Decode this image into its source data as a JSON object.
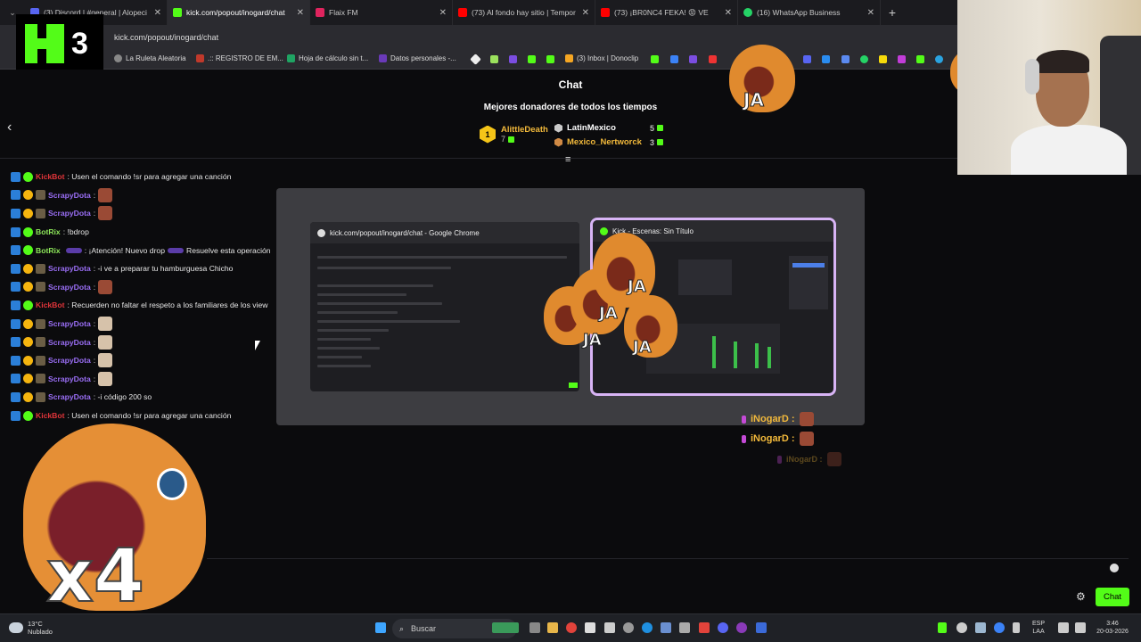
{
  "browser": {
    "tabs": [
      {
        "label": "(3) Discord | #general | Alopeci",
        "color": "#5865f2",
        "active": false
      },
      {
        "label": "kick.com/popout/inogard/chat",
        "color": "#53fc18",
        "active": true
      },
      {
        "label": "Flaix FM",
        "color": "#e0245e",
        "active": false
      },
      {
        "label": "(73) Al fondo hay sitio | Tempor",
        "color": "#ff0000",
        "active": false
      },
      {
        "label": "(73) ¡BR0NC4 FEKA! 😡 VE",
        "color": "#ff0000",
        "active": false
      },
      {
        "label": "(16) WhatsApp Business",
        "color": "#25d366",
        "active": false
      }
    ],
    "url": "kick.com/popout/inogard/chat",
    "bookmarks": [
      {
        "label": "La Ruleta Aleatoria",
        "color": "#888888"
      },
      {
        "label": ".:: REGISTRO DE EM...",
        "color": "#c0392b"
      },
      {
        "label": "Hoja de cálculo sin t...",
        "color": "#1fa463"
      },
      {
        "label": "Datos personales -...",
        "color": "#6a3ab8"
      },
      {
        "label": "(3) Inbox | Donoclip",
        "color": "#f5a623"
      }
    ]
  },
  "logo": {
    "number": "3"
  },
  "chat": {
    "title": "Chat",
    "donors_title": "Mejores donadores de todos los tiempos",
    "top_donor": {
      "rank": "1",
      "name": "AlittleDeath",
      "count": "7"
    },
    "donors": [
      {
        "name": "LatinMexico",
        "count": "5"
      },
      {
        "name": "Mexico_Nertworck",
        "count": "3"
      }
    ],
    "messages": [
      {
        "user": "KickBot",
        "text": ": Usen el comando !sr para agregar una canción"
      },
      {
        "user": "ScrapyDota",
        "text": ":"
      },
      {
        "user": "ScrapyDota",
        "text": ":"
      },
      {
        "user": "BotRix",
        "text": ": !bdrop"
      },
      {
        "user": "BotRix",
        "text": ": ¡Atención! Nuevo drop",
        "extra": "Resuelve esta operación"
      },
      {
        "user": "ScrapyDota",
        "text": ": -i ve a preparar tu hamburguesa Chicho"
      },
      {
        "user": "ScrapyDota",
        "text": ":"
      },
      {
        "user": "KickBot",
        "text": ": Recuerden no faltar el respeto a los familiares de los view"
      },
      {
        "user": "ScrapyDota",
        "text": ":"
      },
      {
        "user": "ScrapyDota",
        "text": ":"
      },
      {
        "user": "ScrapyDota",
        "text": ":"
      },
      {
        "user": "ScrapyDota",
        "text": ":"
      },
      {
        "user": "ScrapyDota",
        "text": ": -i código 200 so"
      },
      {
        "user": "KickBot",
        "text": ": Usen el comando !sr para agregar una canción"
      }
    ],
    "role_rows": [
      "iNogarD :",
      "iNogarD :",
      "iNogarD :"
    ],
    "send_label": "Chat"
  },
  "alttab": {
    "win1_title": "kick.com/popout/inogard/chat - Google Chrome",
    "win2_title": "Kick - Escenas: Sin Título"
  },
  "overlay": {
    "ja": "JA",
    "multiplier": "x4"
  },
  "taskbar": {
    "weather_temp": "13°C",
    "weather_desc": "Nublado",
    "search": "Buscar",
    "lang1": "ESP",
    "lang2": "LAA",
    "time": "3:46",
    "date": "20-03-2026"
  },
  "colors": {
    "kick_green": "#53fc18",
    "donor_gold": "#f2b93b"
  }
}
